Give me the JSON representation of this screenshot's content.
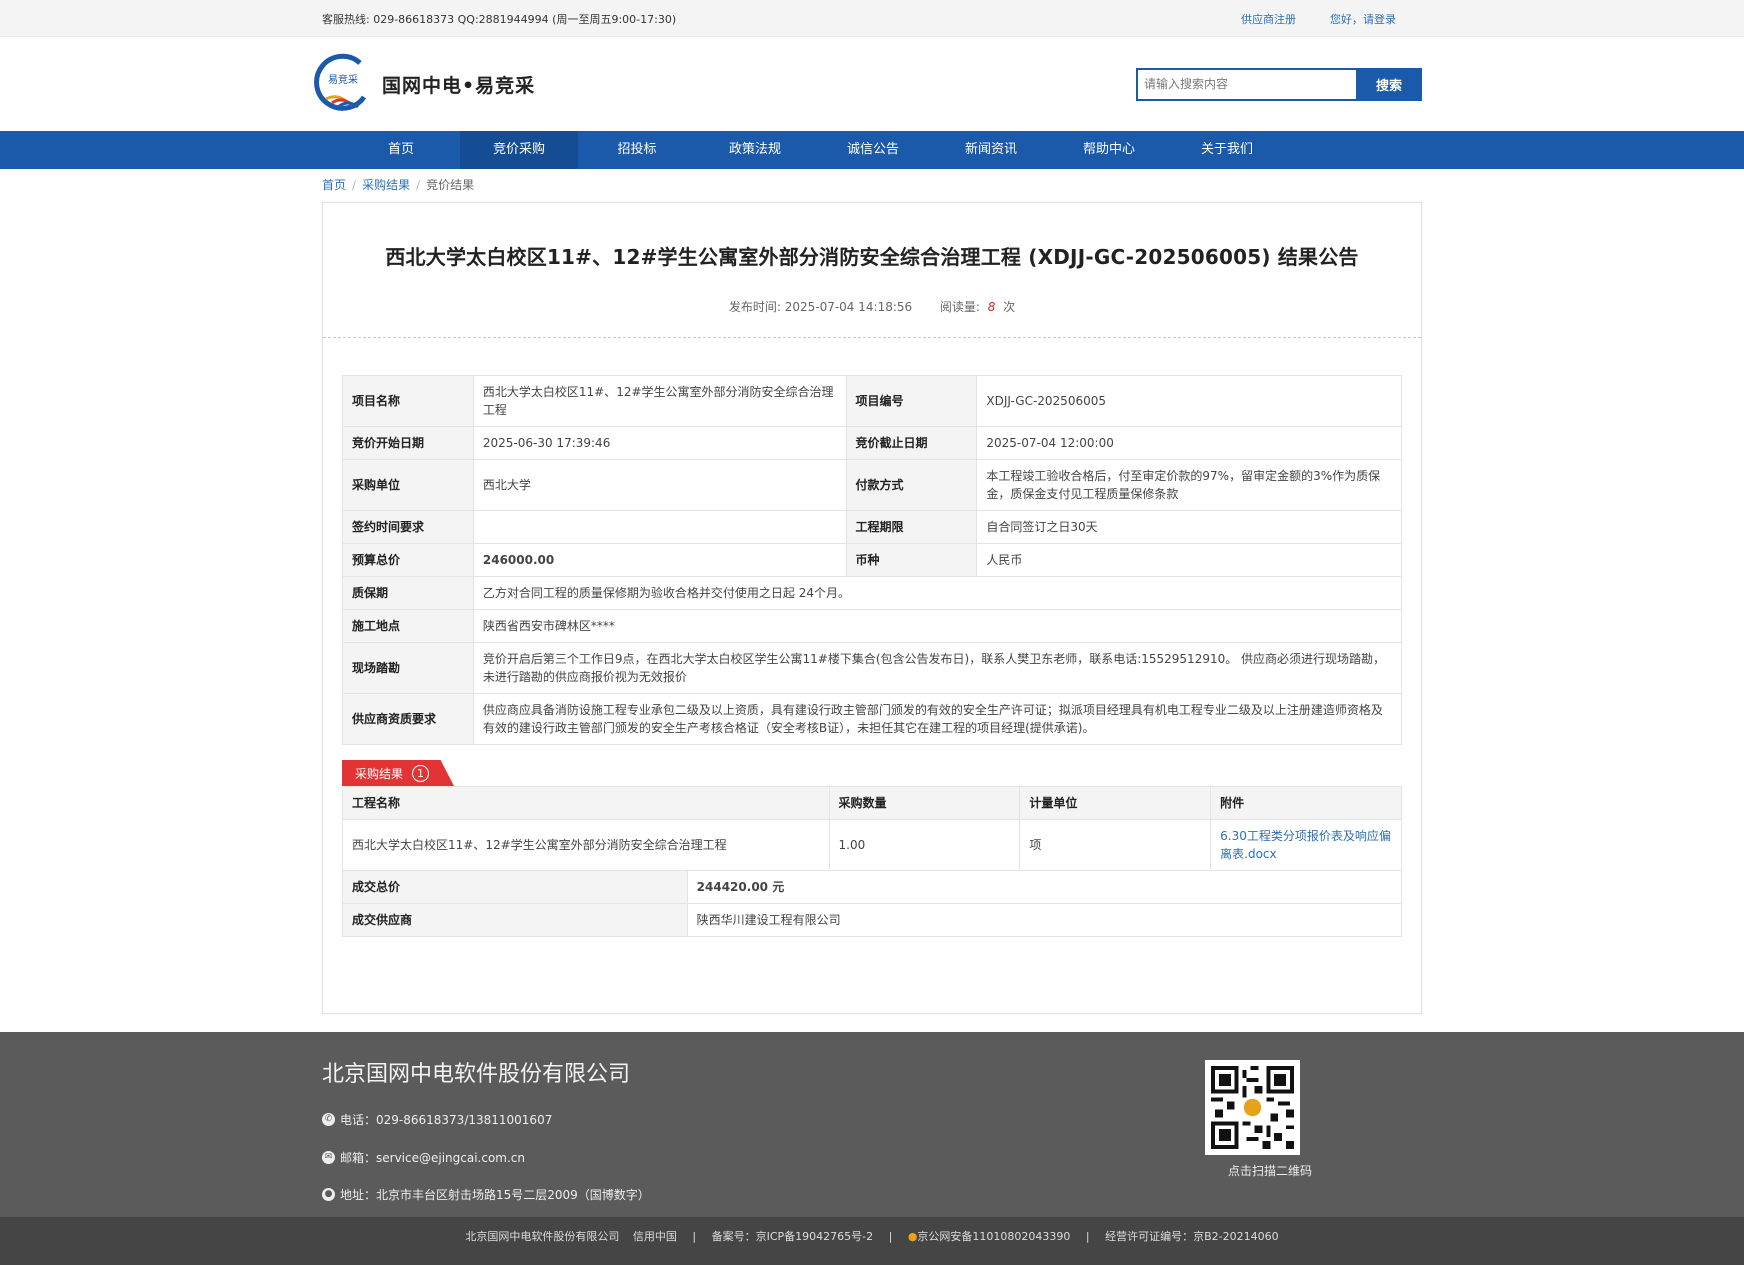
{
  "topbar": {
    "hotline": "客服热线: 029-86618373 QQ:2881944994 (周一至周五9:00-17:30)",
    "register": "供应商注册",
    "login": "您好，请登录"
  },
  "header": {
    "logo_mark_text": "易竞采",
    "logo_text": "国网中电•易竞采",
    "search_placeholder": "请输入搜索内容",
    "search_button": "搜索"
  },
  "nav": {
    "items": [
      "首页",
      "竞价采购",
      "招投标",
      "政策法规",
      "诚信公告",
      "新闻资讯",
      "帮助中心",
      "关于我们"
    ],
    "active_index": 1
  },
  "breadcrumb": {
    "items": [
      "首页",
      "采购结果",
      "竞价结果"
    ],
    "separator": "/"
  },
  "article": {
    "title": "西北大学太白校区11#、12#学生公寓室外部分消防安全综合治理工程 (XDJJ-GC-202506005) 结果公告",
    "publish_label": "发布时间:",
    "publish_time": "2025-07-04 14:18:56",
    "read_label": "阅读量:",
    "read_count": "8",
    "read_unit": "次"
  },
  "info": {
    "project_name_label": "项目名称",
    "project_name": "西北大学太白校区11#、12#学生公寓室外部分消防安全综合治理工程",
    "project_no_label": "项目编号",
    "project_no": "XDJJ-GC-202506005",
    "start_label": "竞价开始日期",
    "start": "2025-06-30 17:39:46",
    "end_label": "竞价截止日期",
    "end": "2025-07-04 12:00:00",
    "buyer_label": "采购单位",
    "buyer": "西北大学",
    "payment_label": "付款方式",
    "payment": "本工程竣工验收合格后，付至审定价款的97%，留审定金额的3%作为质保金，质保金支付见工程质量保修条款",
    "sign_label": "签约时间要求",
    "sign": "",
    "period_label": "工程期限",
    "period": "自合同签订之日30天",
    "budget_label": "预算总价",
    "budget": "246000.00",
    "currency_label": "币种",
    "currency": "人民币",
    "warranty_label": "质保期",
    "warranty": "乙方对合同工程的质量保修期为验收合格并交付使用之日起 24个月。",
    "site_label": "施工地点",
    "site": "陕西省西安市碑林区****",
    "survey_label": "现场踏勘",
    "survey": "竞价开启后第三个工作日9点，在西北大学太白校区学生公寓11#楼下集合(包含公告发布日)，联系人樊卫东老师，联系电话:15529512910。 供应商必须进行现场踏勘，未进行踏勘的供应商报价视为无效报价",
    "qual_label": "供应商资质要求",
    "qual": "供应商应具备消防设施工程专业承包二级及以上资质，具有建设行政主管部门颁发的有效的安全生产许可证；拟派项目经理具有机电工程专业二级及以上注册建造师资格及有效的建设行政主管部门颁发的安全生产考核合格证（安全考核B证），未担任其它在建工程的项目经理(提供承诺)。"
  },
  "result": {
    "tag": "采购结果",
    "tag_count": "1",
    "headers": [
      "工程名称",
      "采购数量",
      "计量单位",
      "附件"
    ],
    "row": {
      "name": "西北大学太白校区11#、12#学生公寓室外部分消防安全综合治理工程",
      "qty": "1.00",
      "unit": "项",
      "attachment": "6.30工程类分项报价表及响应偏离表.docx"
    },
    "total_label": "成交总价",
    "total": "244420.00 元",
    "supplier_label": "成交供应商",
    "supplier": "陕西华川建设工程有限公司"
  },
  "footer": {
    "company": "北京国网中电软件股份有限公司",
    "phone": "电话：029-86618373/13811001607",
    "email": "邮箱：service@ejingcai.com.cn",
    "address": "地址：北京市丰台区射击场路15号二层2009（国博数字）",
    "qr_label": "点击扫描二维码",
    "bottom_company": "北京国网中电软件股份有限公司",
    "bottom_credit": "信用中国",
    "bottom_icp": "备案号：京ICP备19042765号-2",
    "bottom_police": "京公网安备11010802043390",
    "bottom_license": "经营许可证编号：京B2-20214060"
  },
  "colors": {
    "brand_blue": "#1b5aaa",
    "accent_red": "#e23434",
    "footer_gray": "#5b5b5b"
  }
}
